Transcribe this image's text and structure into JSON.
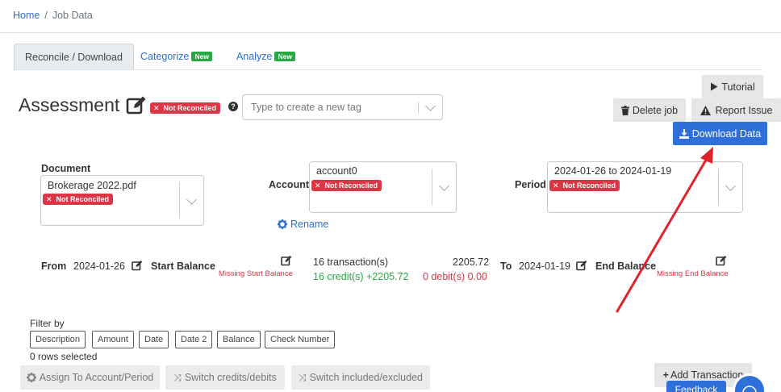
{
  "breadcrumb": {
    "home": "Home",
    "separator": "/",
    "current": "Job Data"
  },
  "tabs": [
    {
      "label": "Reconcile / Download",
      "active": true,
      "badge": ""
    },
    {
      "label": "Categorize",
      "active": false,
      "badge": "New"
    },
    {
      "label": "Analyze",
      "active": false,
      "badge": "New"
    }
  ],
  "header": {
    "title": "Assessment",
    "status_badge": "Not Reconciled",
    "help_glyph": "?",
    "tag_placeholder": "Type to create a new tag"
  },
  "buttons": {
    "tutorial": "Tutorial",
    "delete_job": "Delete job",
    "report_issue": "Report Issue",
    "download_data": "Download Data"
  },
  "document": {
    "label": "Document",
    "value": "Brokerage 2022.pdf",
    "status": "Not Reconciled"
  },
  "account": {
    "label": "Account",
    "value": "account0",
    "status": "Not Reconciled",
    "rename": "Rename"
  },
  "period": {
    "label": "Period",
    "value": "2024-01-26 to 2024-01-19",
    "status": "Not Reconciled"
  },
  "balances": {
    "from_label": "From",
    "from_date": "2024-01-26",
    "start_label": "Start Balance",
    "start_missing": "Missing Start Balance",
    "transactions": "16 transaction(s)",
    "total": "2205.72",
    "credits": "16 credit(s) +2205.72",
    "debits": "0 debit(s) 0.00",
    "to_label": "To",
    "to_date": "2024-01-19",
    "end_label": "End Balance",
    "end_missing": "Missing End Balance"
  },
  "filter": {
    "label": "Filter by",
    "options": [
      "Description",
      "Amount",
      "Date",
      "Date 2",
      "Balance",
      "Check Number"
    ],
    "rows_selected": "0 rows selected"
  },
  "actions": {
    "assign": "Assign To Account/Period",
    "switch_credits": "Switch credits/debits",
    "switch_included": "Switch included/excluded",
    "add_transaction": "Add Transaction"
  },
  "feedback": "Feedback",
  "colors": {
    "primary": "#2f6fd9",
    "danger": "#dc3545",
    "success": "#28a745",
    "arrow": "#e0232a"
  }
}
